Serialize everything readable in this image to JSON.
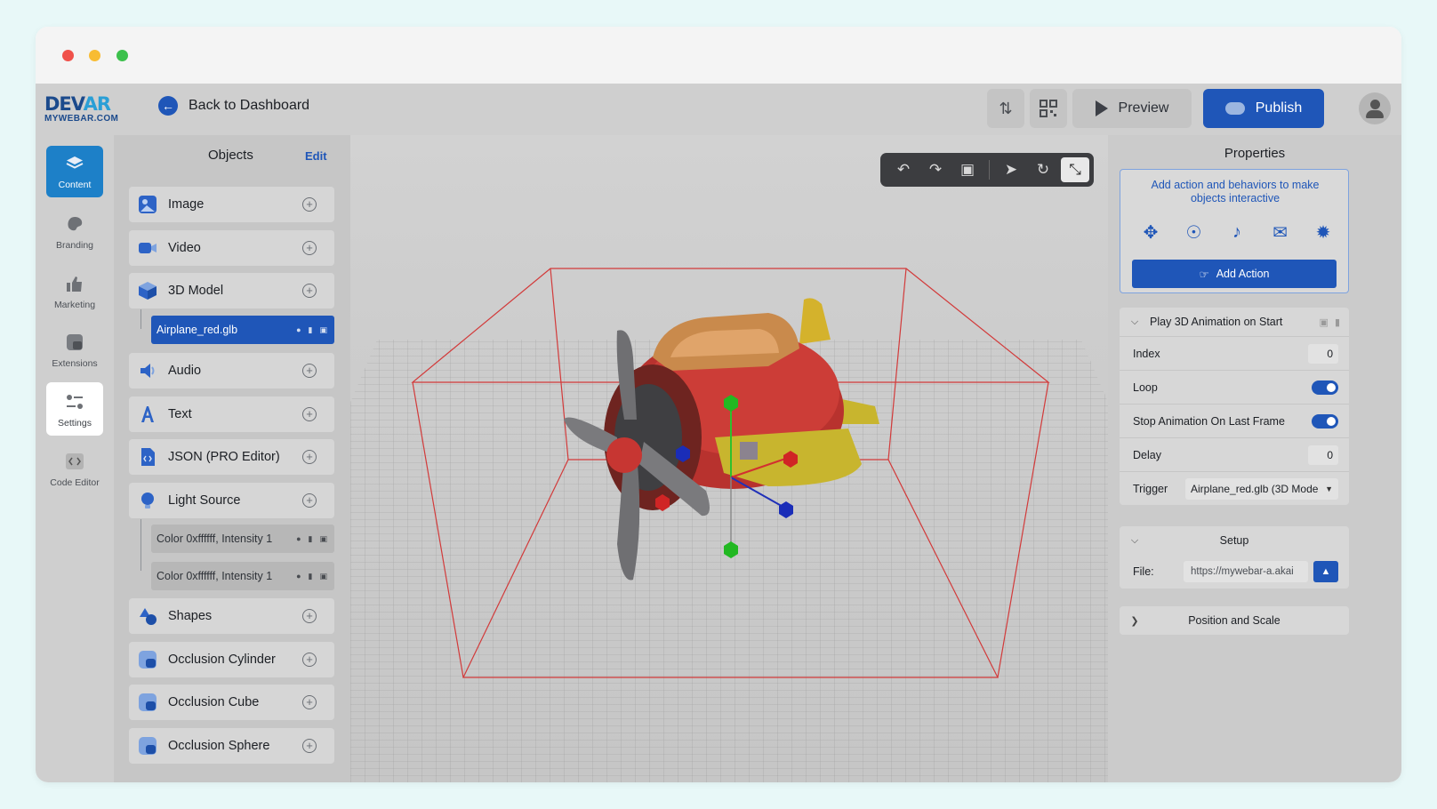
{
  "window": {
    "traffic_lights": [
      "close",
      "minimize",
      "maximize"
    ]
  },
  "brand": {
    "logo_main_a": "DEV",
    "logo_main_b": "AR",
    "logo_sub": "MYWEBAR.COM"
  },
  "topbar": {
    "back_label": "Back to Dashboard",
    "preview_label": "Preview",
    "publish_label": "Publish",
    "colors": {
      "accent": "#1f56b8"
    }
  },
  "nav": {
    "items": [
      {
        "label": "Content",
        "icon": "layers-icon",
        "state": "active"
      },
      {
        "label": "Branding",
        "icon": "palette-icon"
      },
      {
        "label": "Marketing",
        "icon": "thumbs-up-icon"
      },
      {
        "label": "Extensions",
        "icon": "puzzle-icon"
      },
      {
        "label": "Settings",
        "icon": "sliders-icon",
        "state": "selected"
      },
      {
        "label": "Code Editor",
        "icon": "code-icon"
      }
    ]
  },
  "objects": {
    "title": "Objects",
    "edit_label": "Edit",
    "items": [
      {
        "label": "Image",
        "icon": "image-icon"
      },
      {
        "label": "Video",
        "icon": "video-icon"
      },
      {
        "label": "3D Model",
        "icon": "cube-icon"
      },
      {
        "label": "Audio",
        "icon": "speaker-icon"
      },
      {
        "label": "Text",
        "icon": "text-icon"
      },
      {
        "label": "JSON (PRO Editor)",
        "icon": "json-file-icon"
      },
      {
        "label": "Light Source",
        "icon": "lightbulb-icon"
      },
      {
        "label": "Shapes",
        "icon": "shapes-icon"
      },
      {
        "label": "Occlusion Cylinder",
        "icon": "occlusion-icon"
      },
      {
        "label": "Occlusion Cube",
        "icon": "occlusion-icon"
      },
      {
        "label": "Occlusion Sphere",
        "icon": "occlusion-icon"
      }
    ],
    "model_child": "Airplane_red.glb",
    "light_children": [
      "Color 0xffffff, Intensity 1",
      "Color 0xffffff, Intensity 1"
    ]
  },
  "viewport": {
    "tools": [
      "undo-icon",
      "redo-icon",
      "save-icon",
      "select-icon",
      "rotate-icon",
      "scale-icon"
    ]
  },
  "properties": {
    "title": "Properties",
    "action_hint": "Add action and behaviors to make objects interactive",
    "action_icons": [
      "transform-icon",
      "globe-icon",
      "sound-icon",
      "mail-icon",
      "person-icon"
    ],
    "add_action_label": "Add Action",
    "animation": {
      "header": "Play 3D Animation on Start",
      "index_label": "Index",
      "index_value": "0",
      "loop_label": "Loop",
      "loop_on": true,
      "stop_label": "Stop Animation On Last Frame",
      "stop_on": true,
      "delay_label": "Delay",
      "delay_value": "0",
      "trigger_label": "Trigger",
      "trigger_value": "Airplane_red.glb (3D Mode"
    },
    "setup": {
      "header": "Setup",
      "file_label": "File:",
      "file_value": "https://mywebar-a.akai"
    },
    "position": {
      "header": "Position and Scale"
    }
  }
}
